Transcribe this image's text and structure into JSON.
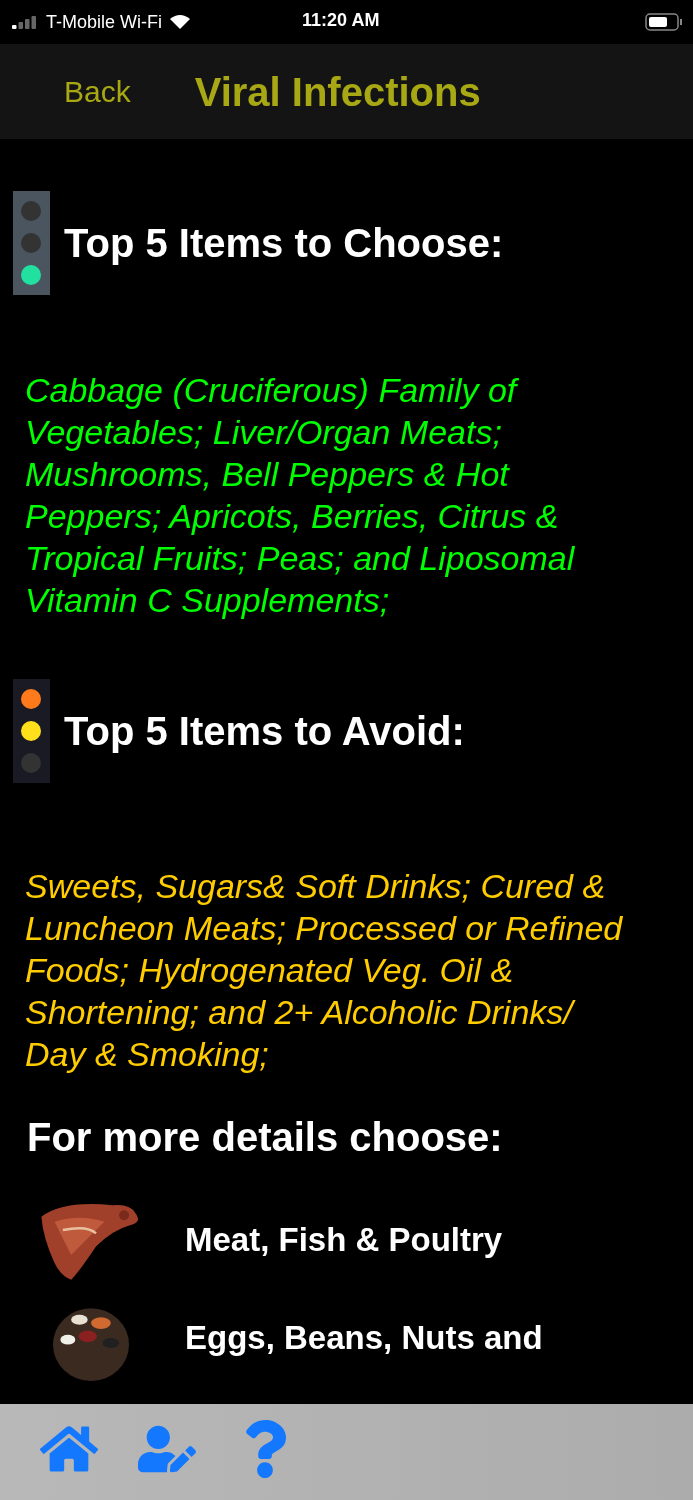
{
  "status_bar": {
    "carrier": "T-Mobile Wi-Fi",
    "time": "11:20 AM"
  },
  "nav": {
    "back": "Back",
    "title": "Viral Infections"
  },
  "sections": [
    {
      "kind": "go",
      "heading": "Top 5 Items to Choose:",
      "color": "#00ff00",
      "text": "Cabbage (Cruciferous) Family of Vegetables; Liver/Organ Meats; Mushrooms, Bell Peppers & Hot Peppers; Apricots, Berries, Citrus & Tropical Fruits; Peas; and Liposomal Vitamin C Supplements;"
    },
    {
      "kind": "caution",
      "heading": "Top 5 Items to Avoid:",
      "color": "#ffcc00",
      "text": "Sweets, Sugars& Soft Drinks; Cured & Luncheon Meats; Processed or Refined Foods; Hydrogenated Veg. Oil & Shortening; and 2+ Alcoholic Drinks/ Day & Smoking;"
    }
  ],
  "details": {
    "heading": "For more details choose:",
    "items": [
      {
        "kind": "meat",
        "label": "Meat, Fish & Poultry"
      },
      {
        "kind": "beans",
        "label": "Eggs, Beans, Nuts and"
      }
    ]
  },
  "tab_bar": {
    "items": [
      {
        "kind": "home"
      },
      {
        "kind": "profile"
      },
      {
        "kind": "help"
      }
    ]
  }
}
